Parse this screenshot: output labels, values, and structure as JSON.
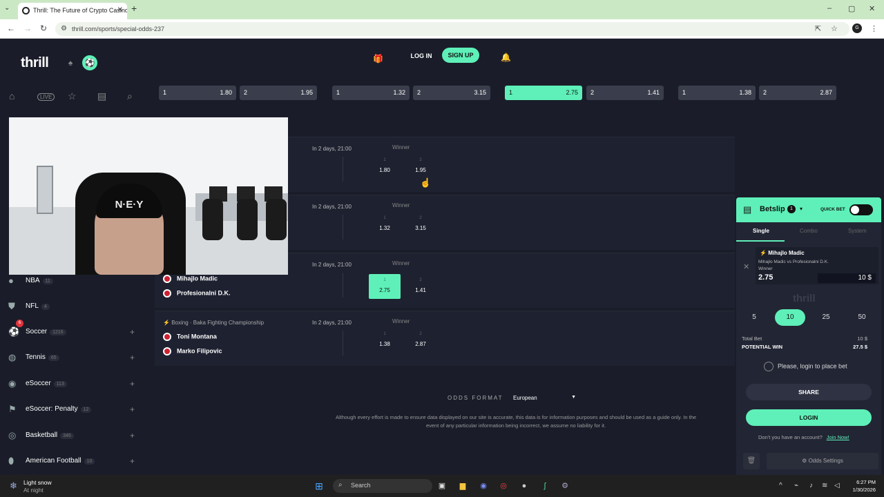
{
  "browser": {
    "tab_title": "Thrill: The Future of Crypto Casino",
    "url": "thrill.com/sports/special-odds-237"
  },
  "header": {
    "logo": "thrill",
    "login_label": "LOG IN",
    "signup_label": "SIGN UP"
  },
  "odds_strip": [
    {
      "a_label": "1",
      "a_odds": "1.80",
      "b_label": "2",
      "b_odds": "1.95",
      "selected": ""
    },
    {
      "a_label": "1",
      "a_odds": "1.32",
      "b_label": "2",
      "b_odds": "3.15",
      "selected": ""
    },
    {
      "a_label": "1",
      "a_odds": "2.75",
      "b_label": "2",
      "b_odds": "1.41",
      "selected": "a"
    },
    {
      "a_label": "1",
      "a_odds": "1.38",
      "b_label": "2",
      "b_odds": "2.87",
      "selected": ""
    }
  ],
  "sidebar": {
    "sports": [
      {
        "name": "NBA",
        "count": "11"
      },
      {
        "name": "NFL",
        "count": "4"
      },
      {
        "name": "Soccer",
        "count": "1216"
      },
      {
        "name": "Tennis",
        "count": "65"
      },
      {
        "name": "eSoccer",
        "count": "113"
      },
      {
        "name": "eSoccer: Penalty",
        "count": "12"
      },
      {
        "name": "Basketball",
        "count": "346"
      },
      {
        "name": "American Football",
        "count": "10"
      }
    ],
    "soccer_badge": "6"
  },
  "events": [
    {
      "league": "",
      "team1": "",
      "team2": "",
      "time": "In 2 days, 21:00",
      "market": "Winner",
      "o1_label": "1",
      "o1": "1.80",
      "o2_label": "2",
      "o2": "1.95",
      "selected": ""
    },
    {
      "league": "",
      "team1": "",
      "team2": "",
      "time": "In 2 days, 21:00",
      "market": "Winner",
      "o1_label": "1",
      "o1": "1.32",
      "o2_label": "2",
      "o2": "3.15",
      "selected": ""
    },
    {
      "league": "",
      "team1": "Mihajlo Madic",
      "team2": "Profesionalni D.K.",
      "time": "In 2 days, 21:00",
      "market": "Winner",
      "o1_label": "1",
      "o1": "2.75",
      "o2_label": "2",
      "o2": "1.41",
      "selected": "1"
    },
    {
      "league": "Boxing · Baka Fighting Championship",
      "team1": "Toni Montana",
      "team2": "Marko Filipovic",
      "time": "In 2 days, 21:00",
      "market": "Winner",
      "o1_label": "1",
      "o1": "1.38",
      "o2_label": "2",
      "o2": "2.87",
      "selected": ""
    }
  ],
  "odds_format": {
    "label": "ODDS FORMAT",
    "value": "European",
    "disclaimer": "Although every effort is made to ensure data displayed on our site is accurate, this data is for information purposes and should be used as a guide only. In the event of any particular information being incorrect, we assume no liability for it."
  },
  "betslip": {
    "title": "Betslip",
    "count": "1",
    "quick_bet": "QUICK BET",
    "tabs": [
      "Single",
      "Combo",
      "System"
    ],
    "bet": {
      "selection": "Mihajlo Madic",
      "match": "Mihajlo Madic vs Profesionalni D.K.",
      "market": "Winner",
      "odds": "2.75",
      "stake": "10 $"
    },
    "watermark": "thrill",
    "chips": [
      "5",
      "10",
      "25",
      "50"
    ],
    "total_bet_label": "Total Bet",
    "total_bet_value": "10 $",
    "potential_win_label": "POTENTIAL WIN",
    "potential_win_value": "27.5 $",
    "login_note": "Please, login to place bet",
    "share_label": "SHARE",
    "login_label": "LOGIN",
    "account_text": "Don't you have an account?",
    "join_label": "Join Now!",
    "settings_label": "Odds Settings"
  },
  "webcam": {
    "cap_text": "N·E·Y"
  },
  "taskbar": {
    "weather_title": "Light snow",
    "weather_sub": "At night",
    "search_label": "Search",
    "time": "6:27 PM",
    "date": "1/30/2026"
  }
}
